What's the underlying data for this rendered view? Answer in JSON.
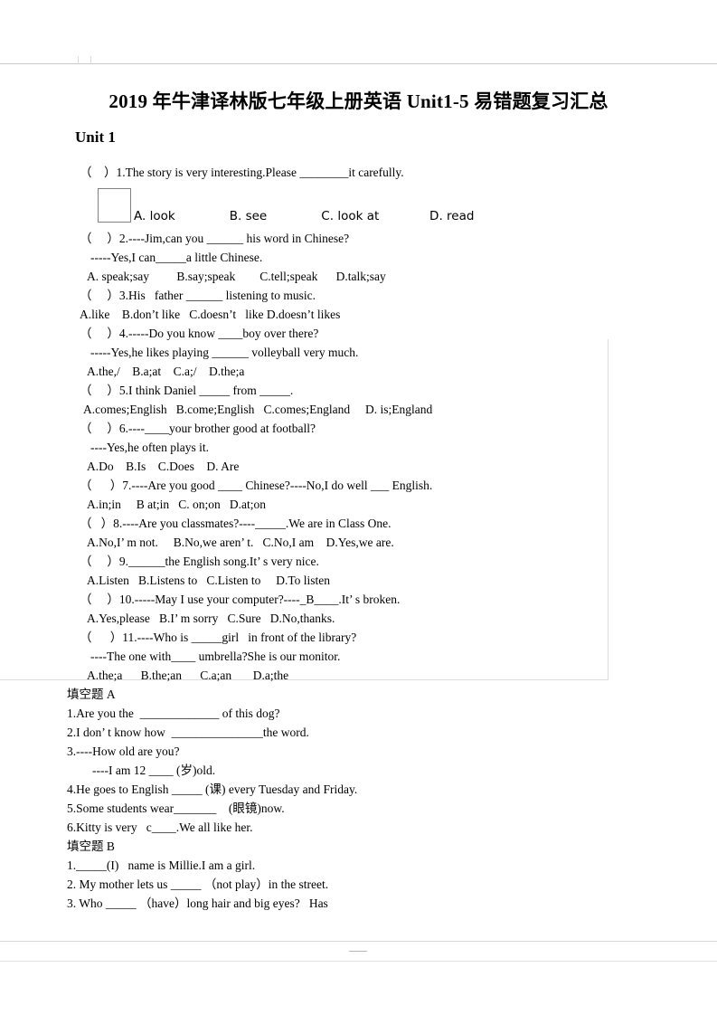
{
  "document": {
    "title": "2019 年牛津译林版七年级上册英语 Unit1-5 易错题复习汇总",
    "unit_heading": "Unit 1"
  },
  "question_one": {
    "stem": "（    ）1.The story is very interesting.Please ________it carefully.",
    "options": "A. look              B. see              C. look at             D. read"
  },
  "questions": [
    {
      "id": "q2-stem",
      "text": "（     ）2.----Jim,can you ______ his word in Chinese?"
    },
    {
      "id": "q2-sub",
      "text": "-----Yes,I can_____a little Chinese."
    },
    {
      "id": "q2-options",
      "text": "A. speak;say         B.say;speak        C.tell;speak      D.talk;say"
    },
    {
      "id": "q3-stem",
      "text": "（     ）3.His   father ______ listening to music."
    },
    {
      "id": "q3-options",
      "text": "A.like    B.don’t like   C.doesn’t   like D.doesn’t likes"
    },
    {
      "id": "q4-stem",
      "text": "（     ）4.-----Do you know ____boy over there?"
    },
    {
      "id": "q4-sub",
      "text": "-----Yes,he likes playing ______ volleyball very much."
    },
    {
      "id": "q4-options",
      "text": "A.the,/    B.a;at    C.a;/    D.the;a"
    },
    {
      "id": "q5-stem",
      "text": "（     ）5.I think Daniel _____ from _____."
    },
    {
      "id": "q5-options",
      "text": "A.comes;English   B.come;English   C.comes;England     D. is;England"
    },
    {
      "id": "q6-stem",
      "text": "（     ）6.----____your brother good at football?"
    },
    {
      "id": "q6-sub",
      "text": "----Yes,he often plays it."
    },
    {
      "id": "q6-options",
      "text": "A.Do    B.Is    C.Does    D. Are"
    },
    {
      "id": "q7-stem",
      "text": "（      ）7.----Are you good ____ Chinese?----No,I do well ___ English."
    },
    {
      "id": "q7-options",
      "text": "A.in;in     B at;in   C. on;on   D.at;on"
    },
    {
      "id": "q8-stem",
      "text": "（   ）8.----Are you classmates?----_____.We are in Class One."
    },
    {
      "id": "q8-options",
      "text": "A.No,I’ m not.     B.No,we aren’ t.   C.No,I am    D.Yes,we are."
    },
    {
      "id": "q9-stem",
      "text": "（     ）9.______the English song.It’ s very nice."
    },
    {
      "id": "q9-options",
      "text": "A.Listen   B.Listens to   C.Listen to     D.To listen"
    },
    {
      "id": "q10-stem",
      "text": "（     ）10.-----May I use your computer?----_B____.It’ s broken."
    },
    {
      "id": "q10-options",
      "text": "A.Yes,please   B.I’ m sorry   C.Sure   D.No,thanks."
    },
    {
      "id": "q11-stem",
      "text": "（      ）11.----Who is _____girl   in front of the library?"
    },
    {
      "id": "q11-sub",
      "text": "----The one with____ umbrella?She is our monitor."
    },
    {
      "id": "q11-options",
      "text": "A.the;a      B.the;an      C.a;an       D.a;the"
    }
  ],
  "fill_section_a": {
    "label": "填空题 A",
    "items": [
      {
        "id": "a1",
        "text": "1.Are you the  _____________ of this dog?"
      },
      {
        "id": "a2",
        "text": "2.I don’ t know how  _______________the word."
      },
      {
        "id": "a3",
        "text": "3.----How old are you?"
      },
      {
        "id": "a3b",
        "text": "----I am 12 ____ (岁)old."
      },
      {
        "id": "a4",
        "text": "4.He goes to English _____ (课) every Tuesday and Friday."
      },
      {
        "id": "a5",
        "text": "5.Some students wear_______    (眼镜)now."
      },
      {
        "id": "a6",
        "text": "6.Kitty is very   c____.We all like her."
      }
    ]
  },
  "fill_section_b": {
    "label": "填空题 B",
    "items": [
      {
        "id": "b1",
        "text": "1._____(I)   name is Millie.I am a girl."
      },
      {
        "id": "b2",
        "text": "2. My mother lets us _____ （not play）in the street."
      },
      {
        "id": "b3",
        "text": "3. Who _____ （have）long hair and big eyes?   Has"
      }
    ]
  }
}
